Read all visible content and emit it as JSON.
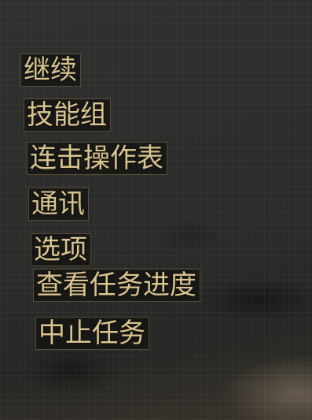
{
  "pause_menu": {
    "items": [
      {
        "label": "继续"
      },
      {
        "label": "技能组"
      },
      {
        "label": "连击操作表"
      },
      {
        "label": "通讯"
      },
      {
        "label": "选项"
      },
      {
        "label": "查看任务进度"
      },
      {
        "label": "中止任务"
      }
    ]
  },
  "colors": {
    "text": "#d9c48f",
    "item_background": "#141312",
    "item_border": "#8c7850",
    "screen_background": "#2c2d2b"
  }
}
